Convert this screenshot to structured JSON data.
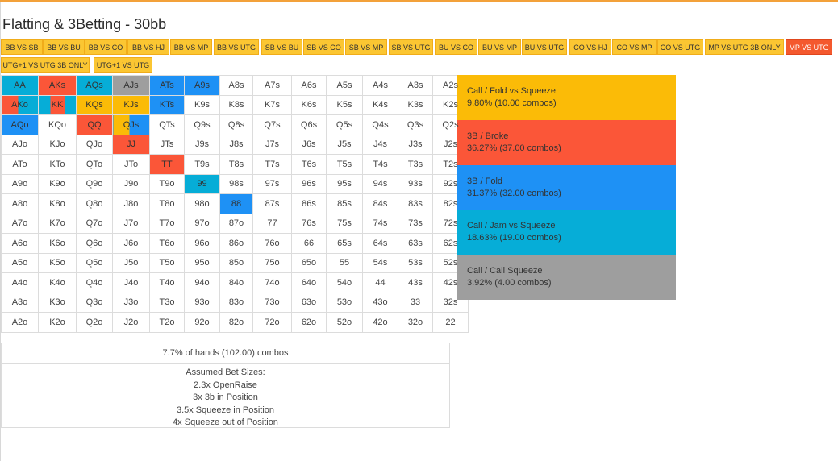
{
  "page": {
    "title": "Flatting & 3Betting - 30bb",
    "accent": "#f3a13a"
  },
  "tabs": [
    {
      "label": "BB VS SB"
    },
    {
      "label": "BB VS BU"
    },
    {
      "label": "BB VS CO"
    },
    {
      "label": "BB VS HJ"
    },
    {
      "label": "BB VS MP"
    },
    {
      "label": "BB VS UTG"
    },
    {
      "label": "SB VS BU"
    },
    {
      "label": "SB VS CO"
    },
    {
      "label": "SB VS MP"
    },
    {
      "label": "SB VS UTG"
    },
    {
      "label": "BU VS CO"
    },
    {
      "label": "BU VS MP"
    },
    {
      "label": "BU VS UTG"
    },
    {
      "label": "CO VS HJ"
    },
    {
      "label": "CO VS MP"
    },
    {
      "label": "CO VS UTG"
    },
    {
      "label": "MP VS UTG 3B ONLY"
    },
    {
      "label": "MP VS UTG",
      "active": true
    },
    {
      "label": "UTG+1 VS UTG 3B ONLY"
    },
    {
      "label": "UTG+1 VS UTG"
    }
  ],
  "actions": [
    {
      "key": "callfold",
      "label": "Call / Fold vs Squeeze",
      "stats": "9.80% (10.00 combos)",
      "color": "#fbbb07"
    },
    {
      "key": "broke",
      "label": "3B / Broke",
      "stats": "36.27% (37.00 combos)",
      "color": "#fb5638"
    },
    {
      "key": "fold3b",
      "label": "3B / Fold",
      "stats": "31.37% (32.00 combos)",
      "color": "#1e91f5"
    },
    {
      "key": "jam",
      "label": "Call / Jam vs Squeeze",
      "stats": "18.63% (19.00 combos)",
      "color": "#06add7"
    },
    {
      "key": "callsq",
      "label": "Call / Call Squeeze",
      "stats": "3.92% (4.00 combos)",
      "color": "#9e9e9e"
    }
  ],
  "grid": {
    "rows": [
      [
        "AA",
        "AKs",
        "AQs",
        "AJs",
        "ATs",
        "A9s",
        "A8s",
        "A7s",
        "A6s",
        "A5s",
        "A4s",
        "A3s",
        "A2s"
      ],
      [
        "AKo",
        "KK",
        "KQs",
        "KJs",
        "KTs",
        "K9s",
        "K8s",
        "K7s",
        "K6s",
        "K5s",
        "K4s",
        "K3s",
        "K2s"
      ],
      [
        "AQo",
        "KQo",
        "QQ",
        "QJs",
        "QTs",
        "Q9s",
        "Q8s",
        "Q7s",
        "Q6s",
        "Q5s",
        "Q4s",
        "Q3s",
        "Q2s"
      ],
      [
        "AJo",
        "KJo",
        "QJo",
        "JJ",
        "JTs",
        "J9s",
        "J8s",
        "J7s",
        "J6s",
        "J5s",
        "J4s",
        "J3s",
        "J2s"
      ],
      [
        "ATo",
        "KTo",
        "QTo",
        "JTo",
        "TT",
        "T9s",
        "T8s",
        "T7s",
        "T6s",
        "T5s",
        "T4s",
        "T3s",
        "T2s"
      ],
      [
        "A9o",
        "K9o",
        "Q9o",
        "J9o",
        "T9o",
        "99",
        "98s",
        "97s",
        "96s",
        "95s",
        "94s",
        "93s",
        "92s"
      ],
      [
        "A8o",
        "K8o",
        "Q8o",
        "J8o",
        "T8o",
        "98o",
        "88",
        "87s",
        "86s",
        "85s",
        "84s",
        "83s",
        "82s"
      ],
      [
        "A7o",
        "K7o",
        "Q7o",
        "J7o",
        "T7o",
        "97o",
        "87o",
        "77",
        "76s",
        "75s",
        "74s",
        "73s",
        "72s"
      ],
      [
        "A6o",
        "K6o",
        "Q6o",
        "J6o",
        "T6o",
        "96o",
        "86o",
        "76o",
        "66",
        "65s",
        "64s",
        "63s",
        "62s"
      ],
      [
        "A5o",
        "K5o",
        "Q5o",
        "J5o",
        "T5o",
        "95o",
        "85o",
        "75o",
        "65o",
        "55",
        "54s",
        "53s",
        "52s"
      ],
      [
        "A4o",
        "K4o",
        "Q4o",
        "J4o",
        "T4o",
        "94o",
        "84o",
        "74o",
        "64o",
        "54o",
        "44",
        "43s",
        "42s"
      ],
      [
        "A3o",
        "K3o",
        "Q3o",
        "J3o",
        "T3o",
        "93o",
        "83o",
        "73o",
        "63o",
        "53o",
        "43o",
        "33",
        "32s"
      ],
      [
        "A2o",
        "K2o",
        "Q2o",
        "J2o",
        "T2o",
        "92o",
        "82o",
        "72o",
        "62o",
        "52o",
        "42o",
        "32o",
        "22"
      ]
    ],
    "cell_actions": {
      "AA": [
        [
          "jam",
          1
        ]
      ],
      "AKs": [
        [
          "broke",
          1
        ]
      ],
      "AQs": [
        [
          "jam",
          1
        ]
      ],
      "AJs": [
        [
          "callsq",
          1
        ]
      ],
      "ATs": [
        [
          "fold3b",
          1
        ]
      ],
      "A9s": [
        [
          "fold3b",
          1
        ]
      ],
      "AKo": [
        [
          "broke",
          0.45
        ],
        [
          "jam",
          0.55
        ]
      ],
      "KK": [
        [
          "jam",
          0.3
        ],
        [
          "broke",
          0.4
        ],
        [
          "jam",
          0.3
        ]
      ],
      "KQs": [
        [
          "callfold",
          1
        ]
      ],
      "KJs": [
        [
          "callfold",
          1
        ]
      ],
      "KTs": [
        [
          "fold3b",
          1
        ]
      ],
      "AQo": [
        [
          "fold3b",
          1
        ]
      ],
      "QQ": [
        [
          "broke",
          1
        ]
      ],
      "QJs": [
        [
          "callfold",
          0.45
        ],
        [
          "fold3b",
          0.55
        ]
      ],
      "JJ": [
        [
          "broke",
          1
        ]
      ],
      "TT": [
        [
          "broke",
          1
        ]
      ],
      "99": [
        [
          "jam",
          1
        ]
      ],
      "88": [
        [
          "fold3b",
          1
        ]
      ]
    },
    "summary": "7.7% of hands (102.00) combos"
  },
  "assumptions": {
    "heading": "Assumed Bet Sizes:",
    "lines": [
      "2.3x OpenRaise",
      "3x 3b in Position",
      "3.5x Squeeze in Position",
      "4x Squeeze out of Position"
    ]
  }
}
